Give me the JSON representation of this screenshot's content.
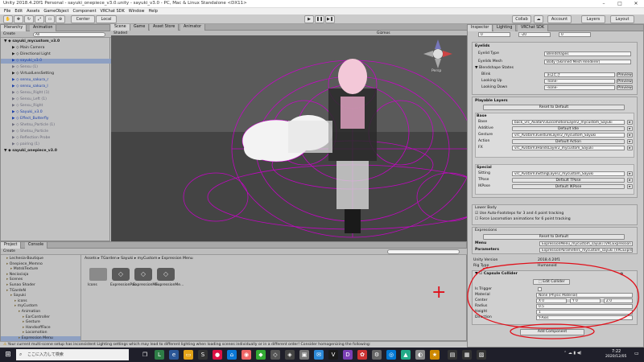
{
  "window": {
    "title": "Unity 2018.4.20f1 Personal - sayuki_onepiece_v3.0.unity - sayuki_v3.0 - PC, Mac & Linux Standalone <DX11>"
  },
  "menu": [
    "File",
    "Edit",
    "Assets",
    "GameObject",
    "Component",
    "VRChat SDK",
    "Window",
    "Help"
  ],
  "toolbar": {
    "center": "Center",
    "local": "Local",
    "collab": "Collab",
    "account": "Account",
    "layers": "Layers",
    "layout": "Layout"
  },
  "hierarchy": {
    "tabs": [
      "Hierarchy",
      "Animation"
    ],
    "create": "Create",
    "search": "All",
    "items": [
      {
        "label": "sayuki_mycustom_v3.0",
        "indent": 0,
        "bold": true,
        "color": "normal"
      },
      {
        "label": "Main Camera",
        "indent": 2,
        "color": "normal"
      },
      {
        "label": "Directional Light",
        "indent": 2,
        "color": "normal"
      },
      {
        "label": "sayuki_v3.0",
        "indent": 2,
        "color": "blue",
        "selected": true
      },
      {
        "label": "Sensu (1)",
        "indent": 2,
        "color": "dim"
      },
      {
        "label": "VirtualLensSetting",
        "indent": 2,
        "color": "normal"
      },
      {
        "label": "sensu_sakura_r",
        "indent": 2,
        "color": "blue"
      },
      {
        "label": "sensu_sakura_l",
        "indent": 2,
        "color": "blue"
      },
      {
        "label": "Sensu_Right (1)",
        "indent": 2,
        "color": "dim"
      },
      {
        "label": "Sensu_Left (1)",
        "indent": 2,
        "color": "dim"
      },
      {
        "label": "Sensu_Right",
        "indent": 2,
        "color": "dim"
      },
      {
        "label": "Sayuki_v3.0",
        "indent": 2,
        "color": "blue"
      },
      {
        "label": "Effect_Butterfly",
        "indent": 2,
        "color": "blue"
      },
      {
        "label": "Shetsu_Particle (1)",
        "indent": 2,
        "color": "dim"
      },
      {
        "label": "Shetsu_Particle",
        "indent": 2,
        "color": "dim"
      },
      {
        "label": "Reflection Probe",
        "indent": 2,
        "color": "dim"
      },
      {
        "label": "pairing (1)",
        "indent": 2,
        "color": "dim"
      },
      {
        "label": "sayuki_onepiece_v3.0",
        "indent": 0,
        "bold": true,
        "color": "normal"
      }
    ]
  },
  "scene": {
    "tabs": [
      "Scene",
      "Game",
      "Asset Store",
      "Animator"
    ],
    "shading": "Shaded",
    "gizmos": "Gizmos",
    "persp": "Persp"
  },
  "project": {
    "tabs": [
      "Project",
      "Console"
    ],
    "create": "Create",
    "breadcrumb": [
      "Assets",
      "TGarden",
      "Sayuki",
      "myCustom",
      "Expression Menu"
    ],
    "tree": [
      {
        "label": "Lechesia-Boutique",
        "indent": 1
      },
      {
        "label": "Onepiece_Memno",
        "indent": 1
      },
      {
        "label": "MatskTexture",
        "indent": 2
      },
      {
        "label": "Neciocioja",
        "indent": 1
      },
      {
        "label": "Scenes",
        "indent": 1
      },
      {
        "label": "Sunao Shader",
        "indent": 1
      },
      {
        "label": "TGardeN",
        "indent": 1
      },
      {
        "label": "Sayuki",
        "indent": 2
      },
      {
        "label": "icons",
        "indent": 3
      },
      {
        "label": "myCustom",
        "indent": 3
      },
      {
        "label": "Animation",
        "indent": 4
      },
      {
        "label": "EarController",
        "indent": 5
      },
      {
        "label": "Gesture",
        "indent": 5
      },
      {
        "label": "HandsoffFace",
        "indent": 5
      },
      {
        "label": "Locomotion",
        "indent": 5
      },
      {
        "label": "Expression Menu",
        "indent": 4,
        "selected": true
      }
    ],
    "files": [
      "Icons",
      "ExpressionPar...",
      "ExpressionMe...",
      "ExpressionMe..."
    ]
  },
  "inspector": {
    "tabs": [
      "Inspector",
      "Lighting",
      "VRChat SDK"
    ],
    "xyz": {
      "x": "0",
      "y": "-20",
      "z": "0"
    },
    "eyelids": {
      "title": "Eyelids",
      "eyelid_type_label": "Eyelid Type",
      "eyelid_type_value": "Blendshapes",
      "mesh_label": "Eyelids Mesh",
      "mesh_value": "Body (Skinned Mesh Renderer)",
      "blendshape_states": "Blendshape States",
      "rows": [
        {
          "label": "Blink",
          "value": "まばたき",
          "btn": "Preview"
        },
        {
          "label": "Looking Up",
          "value": "-none-",
          "btn": "Preview"
        },
        {
          "label": "Looking Down",
          "value": "-none-",
          "btn": "Preview"
        }
      ]
    },
    "playable": {
      "title": "Playable Layers",
      "reset": "Reset to Default",
      "base_title": "Base",
      "base_rows": [
        {
          "label": "Base",
          "value": "back_vrc_AvatarV3LocomotionLayer2_mycustom_Sayuki"
        },
        {
          "label": "Additive",
          "value": "Default Idle"
        },
        {
          "label": "Gesture",
          "value": "vrc_AvatarV3GestureLayer2_mycustom_Sayuki"
        },
        {
          "label": "Action",
          "value": "Default Action"
        },
        {
          "label": "FX",
          "value": "vrc_AvatarV3HandsLayer2_mycustom_Sayuki"
        }
      ],
      "special_title": "Special",
      "special_rows": [
        {
          "label": "Sitting",
          "value": "vrc_AvatarV3SittingLayer2_mycustom_Sayuki"
        },
        {
          "label": "TPose",
          "value": "Default TPose"
        },
        {
          "label": "IKPose",
          "value": "Default IKPose"
        }
      ]
    },
    "lowerbody": {
      "title": "Lower Body",
      "opt1": "Use Auto-Footsteps for 3 and 4 point tracking",
      "opt2": "Force Locomotion animations for 6 point tracking"
    },
    "expressions": {
      "title": "Expressions",
      "reset": "Reset to Default",
      "menu_label": "Menu",
      "menu_value": "ExpressionMenu_mycustom_sayuki (VRCExpression",
      "params_label": "Parameters",
      "params_value": "ExpressionParameters_mycustom_sayuki (VRCExpressi"
    },
    "unity_version_label": "Unity Version",
    "unity_version_value": "2018.4.20f1",
    "rig_type_label": "Rig Type",
    "rig_type_value": "Humanoid",
    "collider": {
      "title": "Capsule Collider",
      "edit": "Edit Collider",
      "is_trigger": "Is Trigger",
      "material_label": "Material",
      "material_value": "None (Physic Material)",
      "center_label": "Center",
      "center": {
        "x": "X 0",
        "y": "Y 0",
        "z": "Z 0"
      },
      "radius_label": "Radius",
      "radius_value": "0.5",
      "height_label": "Height",
      "height_value": "1",
      "direction_label": "Direction",
      "direction_value": "Y-Axis"
    },
    "add_component": "Add Component"
  },
  "status": "Your current multi-scene setup has inconsistent Lighting settings which may lead to different lighting when loading scenes individually or in a different order! Consider homogenizing the following:",
  "taskbar": {
    "search": "ここに入力して検索",
    "time": "7:22",
    "date": "2020/12/05"
  },
  "annotation": {
    "plus": "+"
  },
  "colors": {
    "gizmo": "#d000d0",
    "selection": "#8ea0c2",
    "annotation": "#e0101a",
    "taskbar": "#1f1f2a"
  }
}
